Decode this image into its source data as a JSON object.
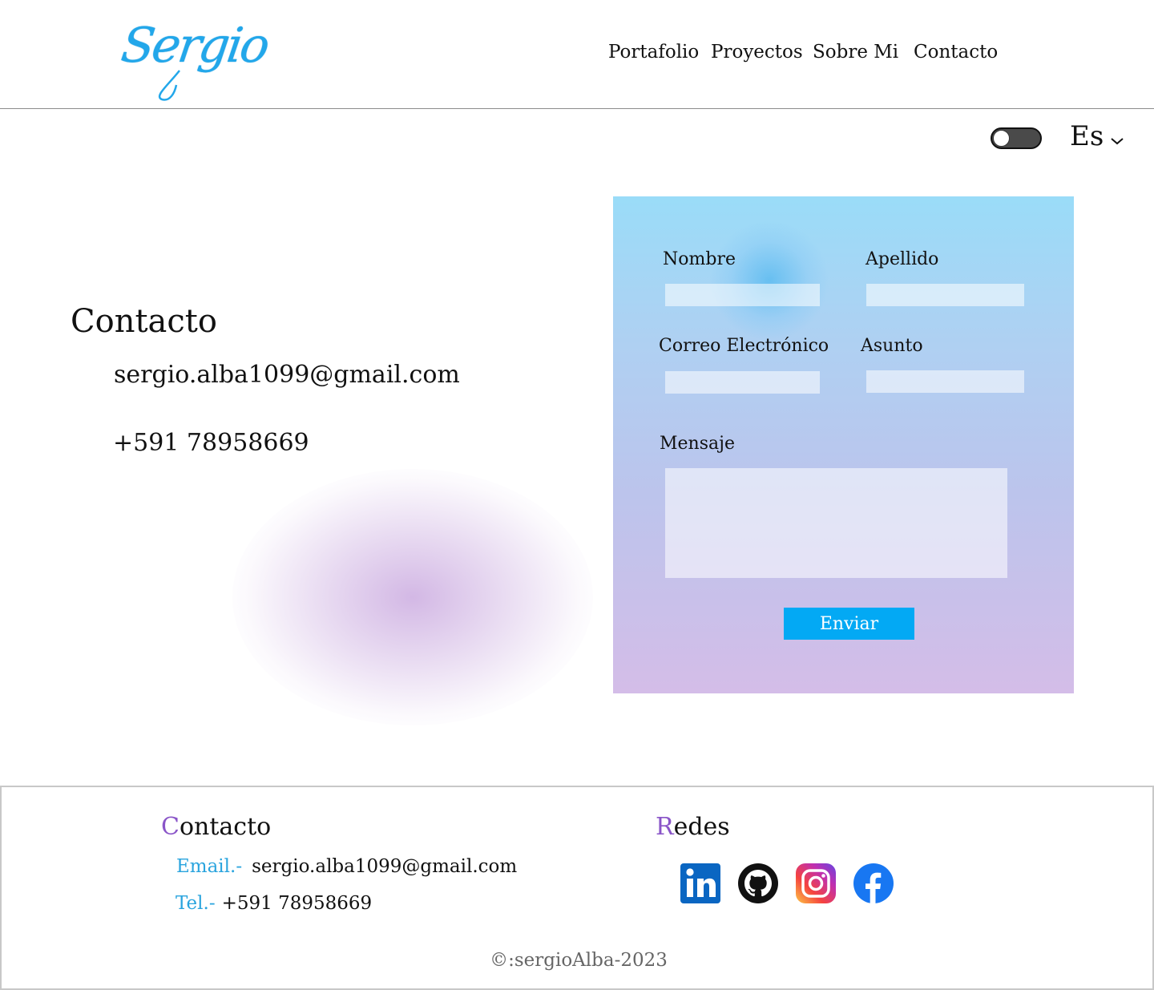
{
  "header": {
    "logo_text": "Sergio",
    "nav": [
      "Portafolio",
      "Proyectos",
      "Sobre Mi",
      "Contacto"
    ]
  },
  "settings": {
    "theme_toggle": "off",
    "language": "Es"
  },
  "contact": {
    "title": "Contacto",
    "email": "sergio.alba1099@gmail.com",
    "phone": "+591 78958669"
  },
  "form": {
    "labels": {
      "nombre": "Nombre",
      "apellido": "Apellido",
      "correo": "Correo Electrónico",
      "asunto": "Asunto",
      "mensaje": "Mensaje"
    },
    "values": {
      "nombre": "",
      "apellido": "",
      "correo": "",
      "asunto": "",
      "mensaje": ""
    },
    "submit_label": "Enviar"
  },
  "footer": {
    "contact_title_first": "C",
    "contact_title_rest": "ontacto",
    "email_key": "Email.-",
    "email_value": "sergio.alba1099@gmail.com",
    "tel_key": "Tel.-",
    "tel_value": "+591 78958669",
    "redes_title_first": "R",
    "redes_title_rest": "edes",
    "social_icons": [
      "linkedin-icon",
      "github-icon",
      "instagram-icon",
      "facebook-icon"
    ],
    "copyright": "©:sergioAlba-2023"
  },
  "colors": {
    "accent_blue": "#03a9f4",
    "logo_blue": "#22a7ea",
    "accent_purple": "#8a55c8",
    "key_blue": "#2aa4de"
  }
}
